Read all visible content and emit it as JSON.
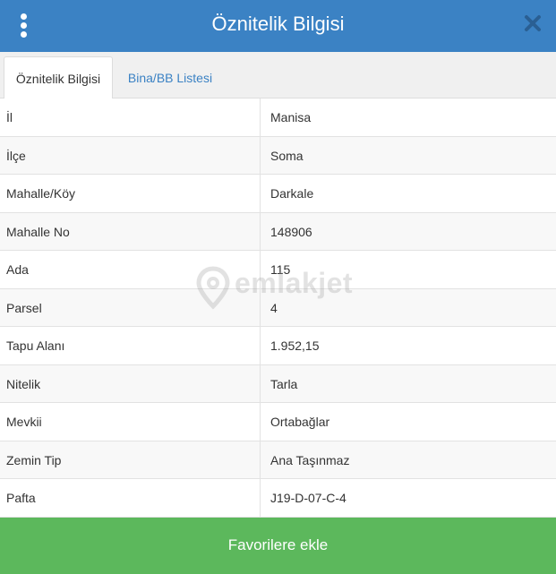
{
  "header": {
    "title": "Öznitelik Bilgisi",
    "menu_icon": "kebab-menu-icon",
    "close_icon": "close-icon",
    "background_color": "#3b82c4"
  },
  "tabs": [
    {
      "label": "Öznitelik Bilgisi",
      "active": true
    },
    {
      "label": "Bina/BB Listesi",
      "active": false
    }
  ],
  "attributes": [
    {
      "key": "İl",
      "value": "Manisa"
    },
    {
      "key": "İlçe",
      "value": "Soma"
    },
    {
      "key": "Mahalle/Köy",
      "value": "Darkale"
    },
    {
      "key": "Mahalle No",
      "value": "148906"
    },
    {
      "key": "Ada",
      "value": "115"
    },
    {
      "key": "Parsel",
      "value": "4"
    },
    {
      "key": "Tapu Alanı",
      "value": "1.952,15"
    },
    {
      "key": "Nitelik",
      "value": "Tarla"
    },
    {
      "key": "Mevkii",
      "value": "Ortabağlar"
    },
    {
      "key": "Zemin Tip",
      "value": "Ana Taşınmaz"
    },
    {
      "key": "Pafta",
      "value": "J19-D-07-C-4"
    }
  ],
  "watermark": {
    "text": "emlakjet",
    "icon": "location-pin-icon"
  },
  "footer": {
    "favorite_label": "Favorilere ekle",
    "button_color": "#5cb85c"
  }
}
